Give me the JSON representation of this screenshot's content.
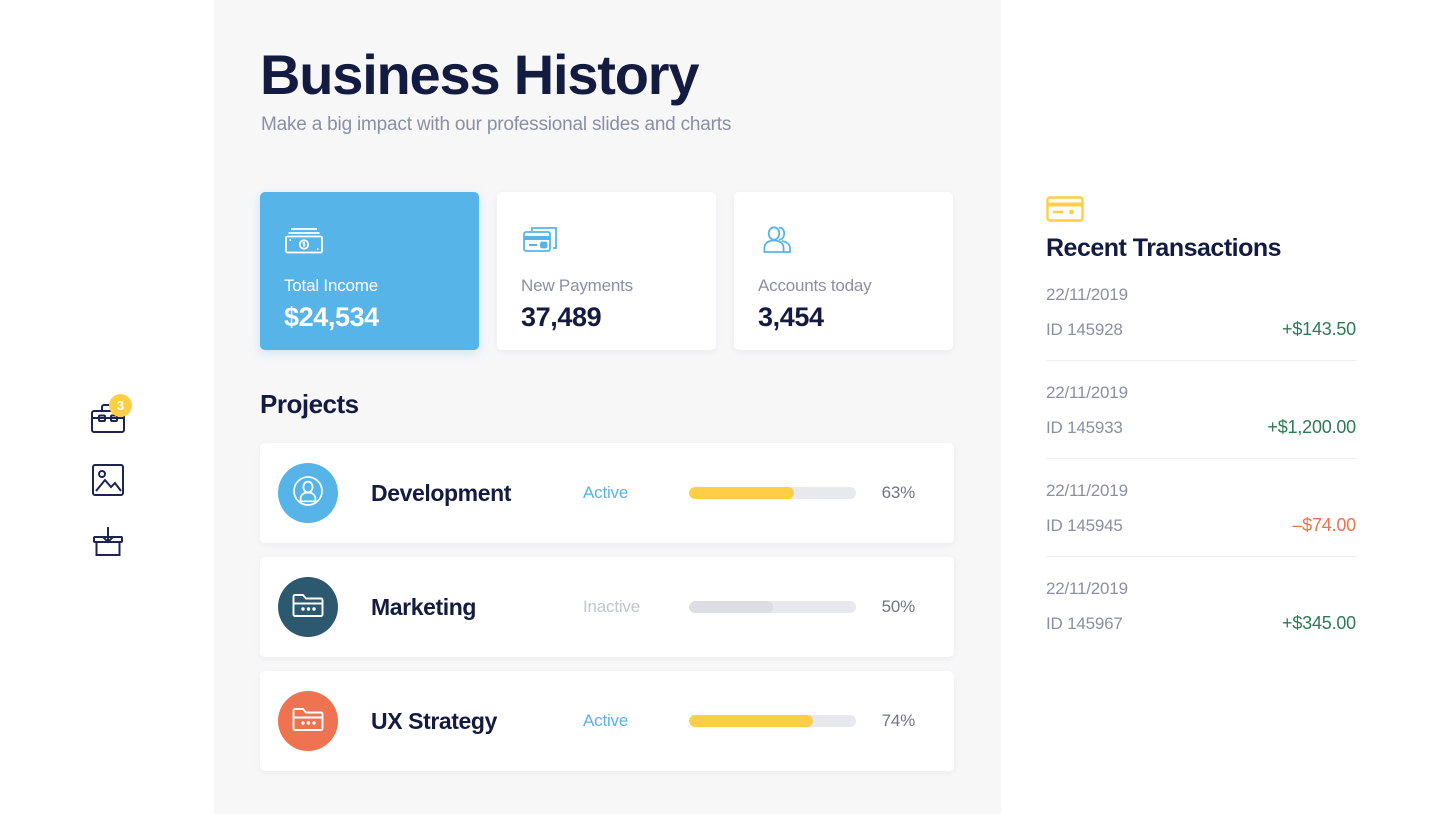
{
  "header": {
    "title": "Business History",
    "subtitle": "Make a big impact with our professional slides and charts"
  },
  "sidebar": {
    "items": [
      {
        "icon": "briefcase-icon",
        "badge": "3"
      },
      {
        "icon": "image-icon",
        "badge": ""
      },
      {
        "icon": "download-box-icon",
        "badge": ""
      }
    ]
  },
  "stats": [
    {
      "label": "Total Income",
      "value": "$24,534",
      "icon": "money-icon",
      "accent": true,
      "color": "#57b4e8"
    },
    {
      "label": "New Payments",
      "value": "37,489",
      "icon": "cards-icon",
      "accent": false,
      "color": "#57b4e8"
    },
    {
      "label": "Accounts today",
      "value": "3,454",
      "icon": "people-icon",
      "accent": false,
      "color": "#57b4e8"
    }
  ],
  "projects": {
    "title": "Projects",
    "items": [
      {
        "name": "Development",
        "status": "Active",
        "percent": "63%",
        "value": 63,
        "icon": "user-avatar-icon",
        "avatar_color": "#57b4e8",
        "active": true
      },
      {
        "name": "Marketing",
        "status": "Inactive",
        "percent": "50%",
        "value": 50,
        "icon": "folder-icon",
        "avatar_color": "#2c5970",
        "active": false
      },
      {
        "name": "UX Strategy",
        "status": "Active",
        "percent": "74%",
        "value": 74,
        "icon": "folder-icon",
        "avatar_color": "#ef7350",
        "active": true
      }
    ]
  },
  "transactions": {
    "icon": "credit-card-icon",
    "heading": "Recent Transactions",
    "items": [
      {
        "date": "22/11/2019",
        "id": "ID 145928",
        "amount": "+$143.50",
        "positive": true
      },
      {
        "date": "22/11/2019",
        "id": "ID 145933",
        "amount": "+$1,200.00",
        "positive": true
      },
      {
        "date": "22/11/2019",
        "id": "ID 145945",
        "amount": "–$74.00",
        "positive": false
      },
      {
        "date": "22/11/2019",
        "id": "ID 145967",
        "amount": "+$345.00",
        "positive": true
      }
    ]
  },
  "colors": {
    "navy": "#141b41",
    "blue": "#57b4e8",
    "yellow": "#ffce45",
    "green": "#2d7a56",
    "orange": "#f0714a",
    "gray_text": "#8a8fa3",
    "panel_bg": "#f7f7f8"
  }
}
